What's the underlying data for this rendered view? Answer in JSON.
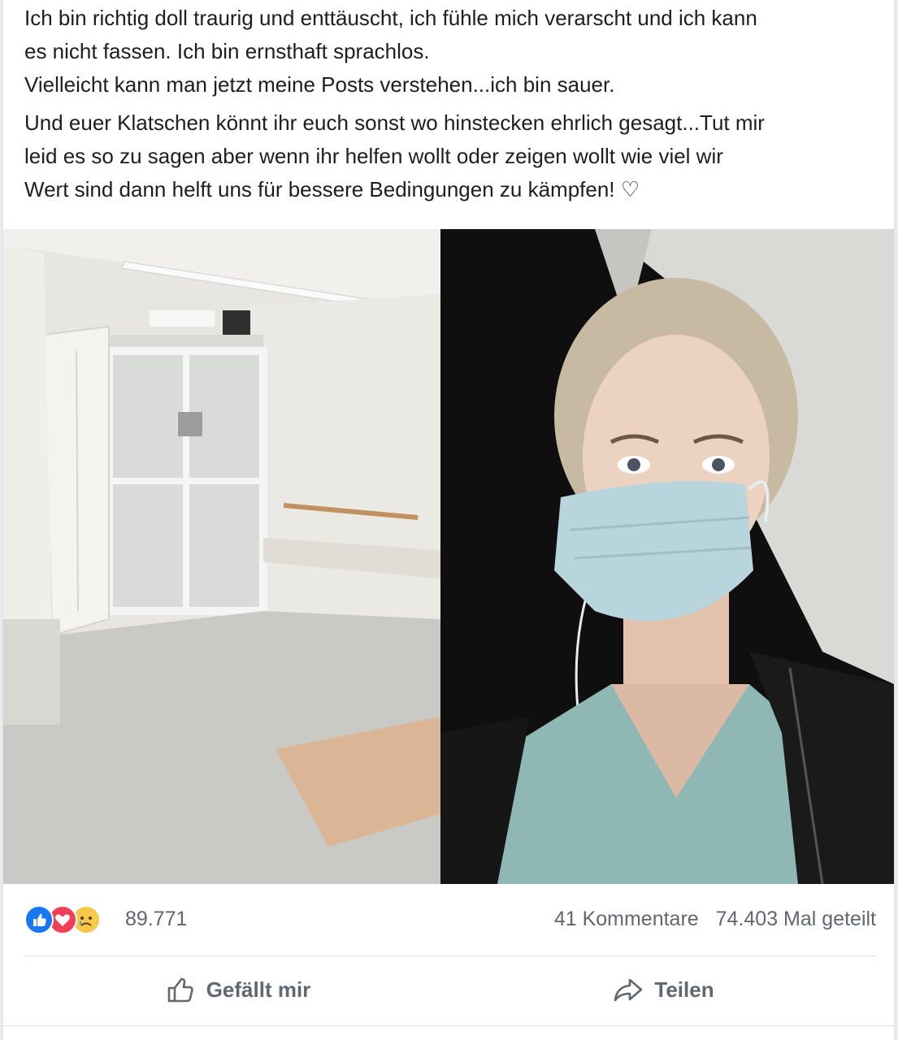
{
  "post": {
    "paragraph1_line1": "Ich bin richtig doll traurig und enttäuscht, ich fühle mich verarscht und ich kann",
    "paragraph1_line2": "es nicht fassen. Ich bin ernsthaft sprachlos.",
    "paragraph1_line3": "Vielleicht kann man jetzt meine Posts verstehen...ich bin sauer.",
    "paragraph2_line1": "Und euer Klatschen könnt ihr euch sonst wo hinstecken ehrlich gesagt...Tut mir",
    "paragraph2_line2": "leid es so zu sagen aber wenn ihr helfen wollt oder zeigen wollt wie viel wir",
    "paragraph2_line3": "Wert sind dann helft uns für bessere Bedingungen zu kämpfen! ♡"
  },
  "reactions": {
    "count": "89.771",
    "comments": "41 Kommentare",
    "shares": "74.403 Mal geteilt",
    "icons": [
      "like-icon",
      "love-icon",
      "sad-icon"
    ]
  },
  "actions": {
    "like_label": "Gefällt mir",
    "share_label": "Teilen"
  },
  "colors": {
    "like": "#1877f2",
    "love": "#f33e58",
    "sad": "#f7c84b",
    "action_text": "#606770"
  }
}
